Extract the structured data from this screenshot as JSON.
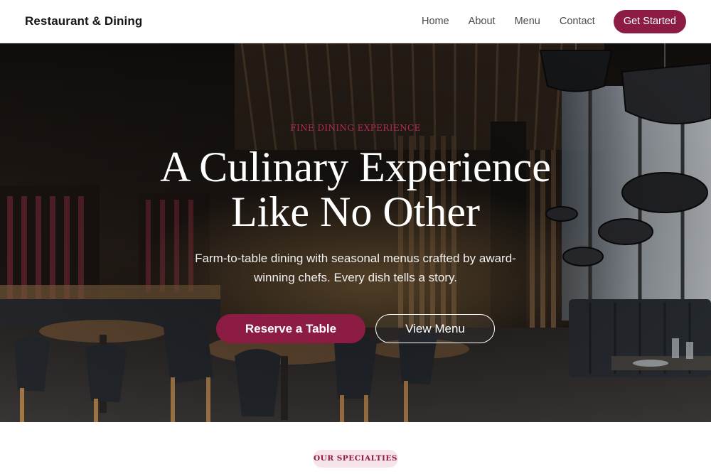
{
  "header": {
    "brand": "Restaurant & Dining",
    "nav": [
      {
        "label": "Home"
      },
      {
        "label": "About"
      },
      {
        "label": "Menu"
      },
      {
        "label": "Contact"
      }
    ],
    "cta_label": "Get Started"
  },
  "hero": {
    "eyebrow": "FINE DINING EXPERIENCE",
    "title_line_1": "A Culinary Experience",
    "title_line_2": "Like No Other",
    "subtitle": "Farm-to-table dining with seasonal menus crafted by award-winning chefs. Every dish tells a story.",
    "primary_button": "Reserve a Table",
    "secondary_button": "View Menu"
  },
  "specialties": {
    "badge": "OUR SPECIALTIES"
  },
  "colors": {
    "accent": "#8c1c44",
    "accent_light": "#f6e4e9",
    "eyebrow": "#b52a58"
  }
}
